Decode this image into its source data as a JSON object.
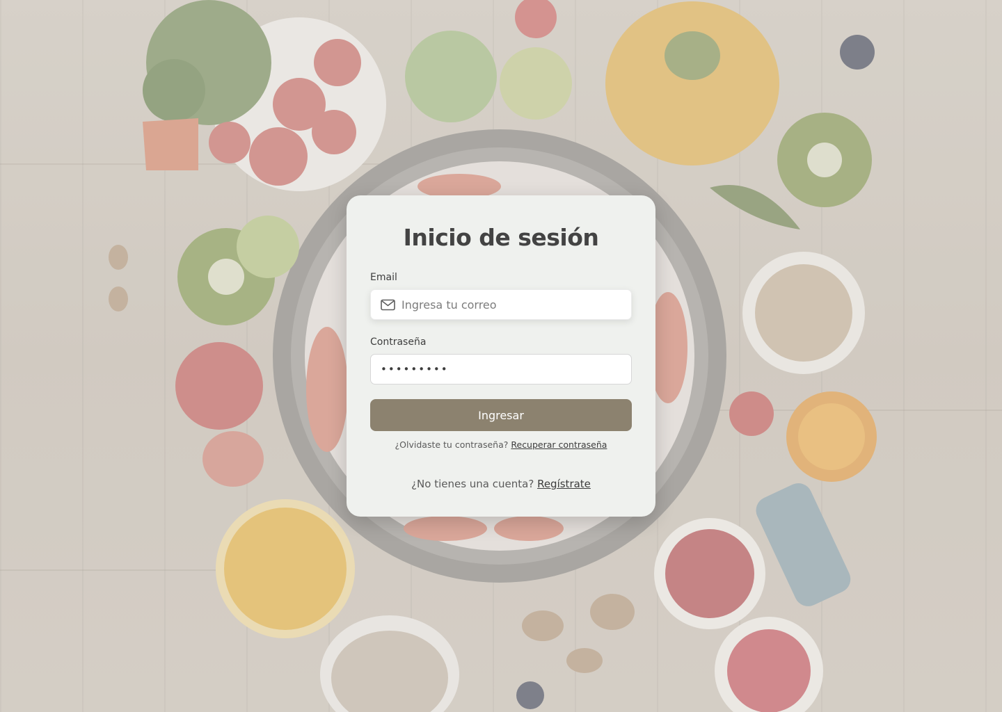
{
  "login": {
    "title": "Inicio de sesión",
    "email_label": "Email",
    "email_placeholder": "Ingresa tu correo",
    "password_label": "Contraseña",
    "password_value": "•••••••••",
    "submit_label": "Ingresar",
    "forgot_prefix": "¿Olvidaste tu contraseña?",
    "forgot_link": "Recuperar contraseña",
    "signup_prefix": "¿No tienes una cuenta?",
    "signup_link": "Regístrate"
  },
  "colors": {
    "button": "#8c826f",
    "card": "#eff1ee",
    "title": "#434343"
  },
  "icons": {
    "email_field_icon": "mail-icon"
  }
}
